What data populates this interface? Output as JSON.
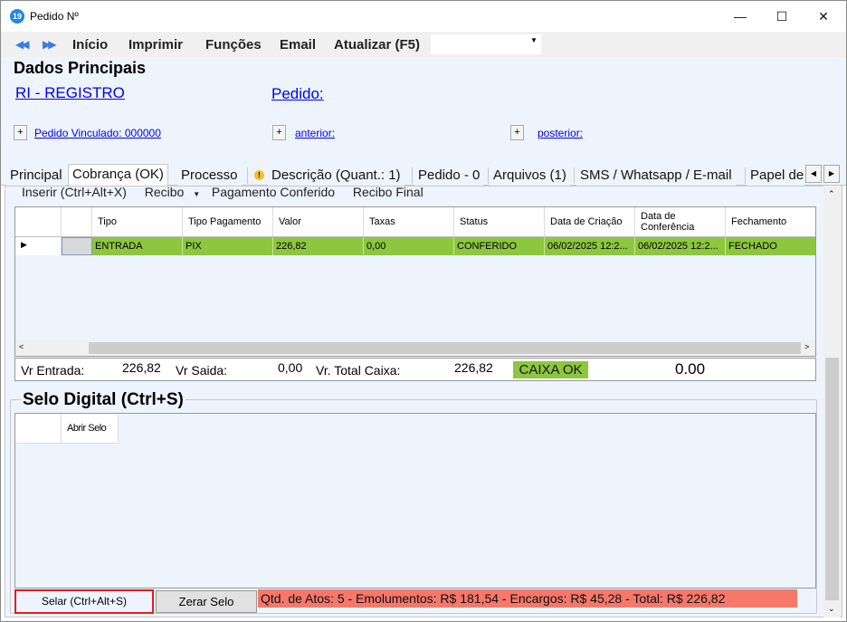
{
  "window": {
    "title": "Pedido Nº",
    "icon_label": "19"
  },
  "menu": {
    "items": [
      "Início",
      "Imprimir",
      "Funções",
      "Email",
      "Atualizar (F5)"
    ],
    "combo_value": ""
  },
  "main": {
    "title": "Dados Principais",
    "registro_link": "RI - REGISTRO",
    "pedido_link": "Pedido:",
    "vinculado_link": "Pedido Vinculado: 000000",
    "anterior_link": "anterior:",
    "posterior_link": "posterior:"
  },
  "tabs": [
    {
      "label": "Principal"
    },
    {
      "label": "Cobrança (OK)"
    },
    {
      "label": "Processo"
    },
    {
      "label": "Descrição (Quant.: 1)"
    },
    {
      "label": "Pedido - 0"
    },
    {
      "label": "Arquivos (1)"
    },
    {
      "label": "SMS / Whatsapp / E-mail"
    },
    {
      "label": "Papel de"
    }
  ],
  "cobranca": {
    "toolbar": {
      "inserir": "Inserir (Ctrl+Alt+X)",
      "recibo": "Recibo",
      "pagamento": "Pagamento Conferido",
      "recibo_final": "Recibo Final"
    },
    "columns": [
      "Tipo",
      "Tipo Pagamento",
      "Valor",
      "Taxas",
      "Status",
      "Data de Criação",
      "Data de Conferência",
      "Fechamento"
    ],
    "rows": [
      {
        "tipo": "ENTRADA",
        "tipo_pagamento": "PIX",
        "valor": "226,82",
        "taxas": "0,00",
        "status": "CONFERIDO",
        "data_criacao": "06/02/2025 12:2...",
        "data_conferencia": "06/02/2025 12:2...",
        "fechamento": "FECHADO"
      }
    ],
    "totals": {
      "entrada_label": "Vr Entrada:",
      "entrada_value": "226,82",
      "saida_label": "Vr Saida:",
      "saida_value": "0,00",
      "total_label": "Vr. Total Caixa:",
      "total_value": "226,82",
      "caixa_status": "CAIXA OK",
      "difference": "0.00"
    }
  },
  "selo": {
    "title": "Selo Digital (Ctrl+S)",
    "column": "Abrir Selo",
    "selar_label": "Selar (Ctrl+Alt+S)",
    "zerar_label": "Zerar Selo",
    "summary": "Qtd. de Atos: 5  -  Emolumentos: R$ 181,54  -  Encargos: R$ 45,28  -  Total: R$ 226,82"
  },
  "colors": {
    "accent_green": "#8dc63f",
    "summary_red": "#f5786b",
    "highlight_border": "#e01f1f",
    "panel_bg": "#edf4fd"
  }
}
